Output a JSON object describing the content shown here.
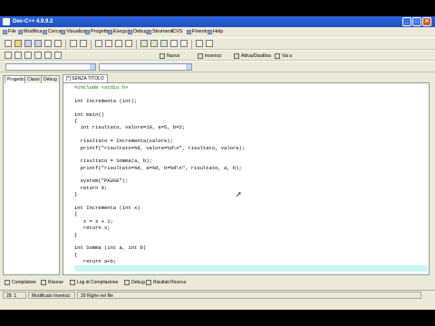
{
  "window": {
    "title": "Dev-C++ 4.9.9.2",
    "min": "_",
    "max": "□",
    "close": "✕"
  },
  "menu": [
    "File",
    "Modifica",
    "Cerca",
    "Visualizza",
    "Progetto",
    "Esegui",
    "Debug",
    "Strumenti",
    "CVS",
    "Finestra",
    "Help"
  ],
  "toolbar2": {
    "nuovo": "Nuovo",
    "inserisci": "Inserisci",
    "attiva": "Attiva/Disattiva",
    "vai": "Vai a"
  },
  "left_tabs": [
    "Progetto",
    "Classi",
    "Debug"
  ],
  "editor": {
    "tab": "[*] SENZA TITOLO",
    "lines": [
      {
        "text": "#include <stdio.h>",
        "kind": "pp"
      },
      {
        "text": ""
      },
      {
        "text": "int Incrementa (int);"
      },
      {
        "text": ""
      },
      {
        "text": "int main()"
      },
      {
        "text": "{"
      },
      {
        "text": "  int risultato, valore=10, a=5, b=2;"
      },
      {
        "text": ""
      },
      {
        "text": "  risultato = Incrementa(valore);"
      },
      {
        "text": "  printf(\"risultato=%d, valore=%d\\n\", risultato, valore);"
      },
      {
        "text": ""
      },
      {
        "text": "  risultato = Somma(a, b);"
      },
      {
        "text": "  printf(\"risultato=%d, a=%d, b=%d\\n\", risultato, a, b);"
      },
      {
        "text": ""
      },
      {
        "text": "  system(\"PAUSE\");"
      },
      {
        "text": "  return 0;"
      },
      {
        "text": "}"
      },
      {
        "text": ""
      },
      {
        "text": "int Incrementa (int x)"
      },
      {
        "text": "{"
      },
      {
        "text": "   x = x + 1;"
      },
      {
        "text": "   return x;"
      },
      {
        "text": "}"
      },
      {
        "text": ""
      },
      {
        "text": "int Somma (int a, int b)"
      },
      {
        "text": "{"
      },
      {
        "text": "   return a+b;"
      },
      {
        "text": "",
        "kind": "hl"
      }
    ]
  },
  "bottom_tabs": [
    "Compilatore",
    "Risorse",
    "Log di Compilazione",
    "Debug",
    "Risultati Ricerca"
  ],
  "status": {
    "position": "28: 1",
    "state": "Modificato Inserisci",
    "lines": "29 Righe nel file"
  }
}
